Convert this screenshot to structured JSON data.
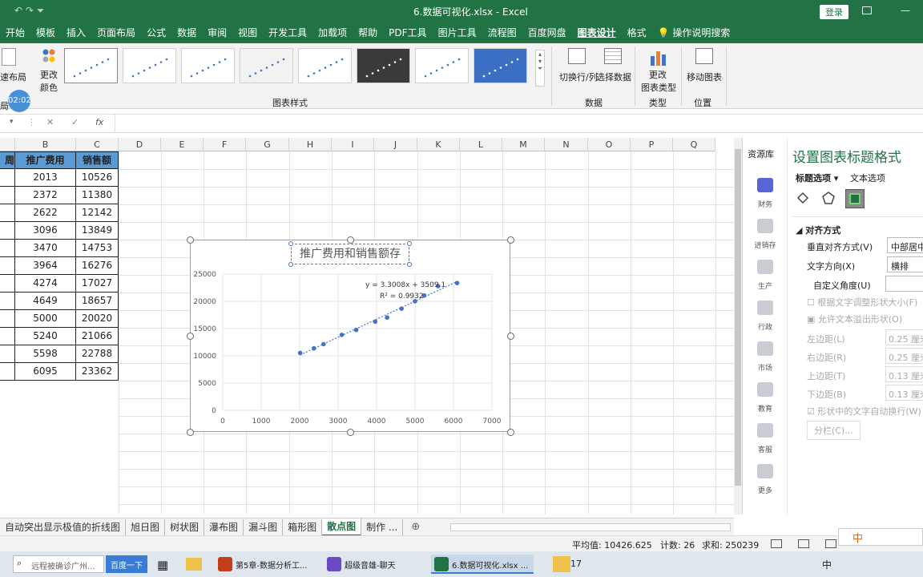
{
  "window": {
    "filename": "6.数据可视化.xlsx",
    "separator": " - ",
    "app": "Excel",
    "login": "登录",
    "quick_access": "↶ ↷ ⏷"
  },
  "ribbon_tabs": [
    "开始",
    "模板",
    "插入",
    "页面布局",
    "公式",
    "数据",
    "审阅",
    "视图",
    "开发工具",
    "加载项",
    "帮助",
    "PDF工具",
    "图片工具",
    "流程图",
    "百度网盘",
    "图表设计",
    "格式"
  ],
  "active_tab": "图表设计",
  "tell_me": "操作说明搜索",
  "ribbon": {
    "quick_layout": "速布局",
    "change_color_line1": "更改",
    "change_color_line2": "颜色",
    "timer": "02:02",
    "chart_styles_group": "图表样式",
    "switch_row_col": "切换行/列",
    "select_data": "选择数据",
    "data_group": "数据",
    "change_type_line1": "更改",
    "change_type_line2": "图表类型",
    "type_group": "类型",
    "move_chart": "移动图表",
    "position_group": "位置",
    "layout_group_stub": "局"
  },
  "formula_bar": {
    "fx": "fx",
    "cancel": "✕",
    "confirm": "✓"
  },
  "columns": [
    "B",
    "C",
    "D",
    "E",
    "F",
    "G",
    "H",
    "I",
    "J",
    "K",
    "L",
    "M",
    "N",
    "O",
    "P",
    "Q"
  ],
  "table": {
    "header_a": "周",
    "header_b": "推广费用",
    "header_c": "销售额",
    "rows": [
      [
        "2013",
        "10526"
      ],
      [
        "2372",
        "11380"
      ],
      [
        "2622",
        "12142"
      ],
      [
        "3096",
        "13849"
      ],
      [
        "3470",
        "14753"
      ],
      [
        "3964",
        "16276"
      ],
      [
        "4274",
        "17027"
      ],
      [
        "4649",
        "18657"
      ],
      [
        "5000",
        "20020"
      ],
      [
        "5240",
        "21066"
      ],
      [
        "5598",
        "22788"
      ],
      [
        "6095",
        "23362"
      ]
    ]
  },
  "chart_data": {
    "type": "scatter",
    "title": "推广费用和销售额存",
    "x": [
      2013,
      2372,
      2622,
      3096,
      3470,
      3964,
      4274,
      4649,
      5000,
      5240,
      5598,
      6095
    ],
    "y": [
      10526,
      11380,
      12142,
      13849,
      14753,
      16276,
      17027,
      18657,
      20020,
      21066,
      22788,
      23362
    ],
    "xlim": [
      0,
      7000
    ],
    "ylim": [
      0,
      25000
    ],
    "x_ticks": [
      "0",
      "1000",
      "2000",
      "3000",
      "4000",
      "5000",
      "6000",
      "7000"
    ],
    "y_ticks": [
      "0",
      "5000",
      "10000",
      "15000",
      "20000",
      "25000"
    ],
    "trendline": {
      "slope": 3.3008,
      "intercept": 3509.1
    },
    "equation_label": "y = 3.3008x + 3509.1",
    "r2_label": "R² = 0.9932",
    "grid": true,
    "point_color": "#4472c4"
  },
  "format_pane": {
    "resource": "资源库",
    "title": "设置图表标题格式",
    "tab_title_options": "标题选项",
    "tab_text_options": "文本选项",
    "section": "对齐方式",
    "vertical_align_label": "垂直对齐方式(V)",
    "vertical_align_value": "中部居中",
    "text_direction_label": "文字方向(X)",
    "text_direction_value": "横排",
    "custom_angle_label": "自定义角度(U)",
    "resize_shape": "根据文字调整形状大小(F)",
    "allow_overflow": "允许文本溢出形状(O)",
    "left_margin_label": "左边距(L)",
    "left_margin_value": "0.25 厘米",
    "right_margin_label": "右边距(R)",
    "right_margin_value": "0.25 厘米",
    "top_margin_label": "上边距(T)",
    "top_margin_value": "0.13 厘米",
    "bottom_margin_label": "下边距(B)",
    "bottom_margin_value": "0.13 厘米",
    "wrap_text": "形状中的文字自动换行(W)",
    "columns_button": "分栏(C)..."
  },
  "resource_sidebar": [
    "财务",
    "进销存",
    "生产",
    "行政",
    "市场",
    "教育",
    "客服",
    "更多"
  ],
  "sheet_tabs": [
    "自动突出显示极值的折线图",
    "旭日图",
    "树状图",
    "瀑布图",
    "漏斗图",
    "箱形图",
    "散点图",
    "制作 ..."
  ],
  "active_sheet": "散点图",
  "status": {
    "average": "平均值: 10426.625",
    "count": "计数: 26",
    "sum": "求和: 250239"
  },
  "taskbar": {
    "search_placeholder": "远程被确诊广州...",
    "search_button": "百度一下",
    "apps": [
      "第5章-数据分析工...",
      "超级音雄-聊天",
      "6.数据可视化.xlsx ..."
    ],
    "tray_number": "17",
    "ime": "中"
  },
  "colors": {
    "excel_green": "#217346",
    "accent_blue": "#4472c4"
  }
}
